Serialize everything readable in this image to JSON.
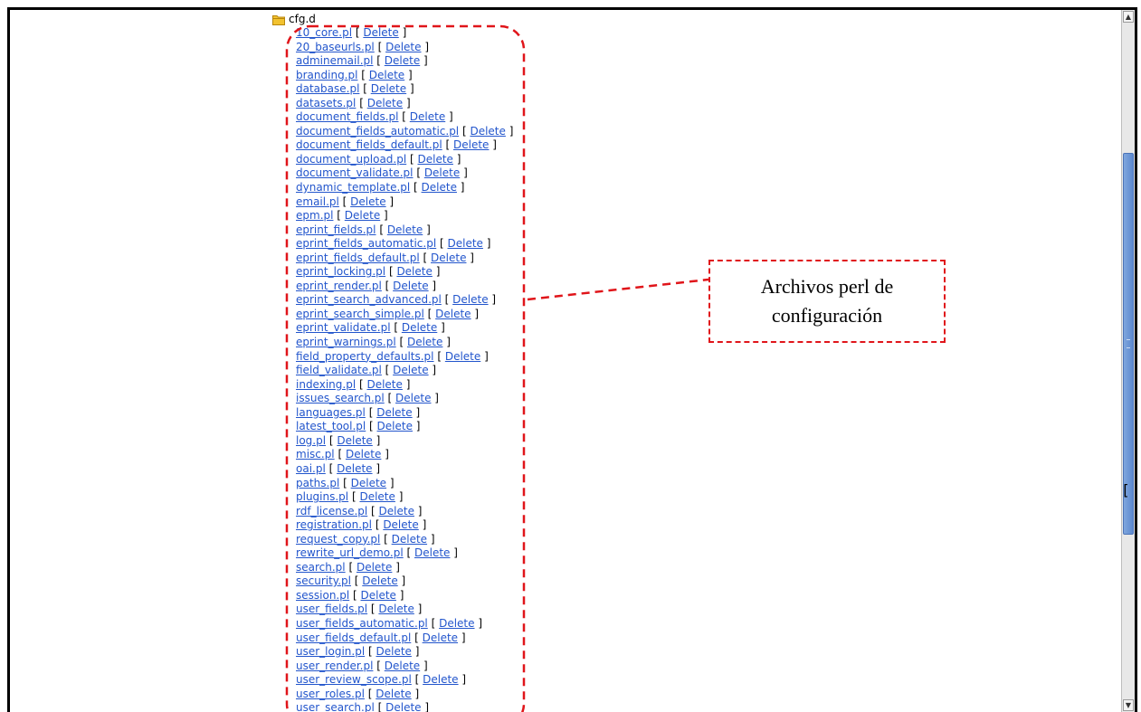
{
  "tree": {
    "folder_name": "cfg.d",
    "delete_label": "Delete",
    "files": [
      "10_core.pl",
      "20_baseurls.pl",
      "adminemail.pl",
      "branding.pl",
      "database.pl",
      "datasets.pl",
      "document_fields.pl",
      "document_fields_automatic.pl",
      "document_fields_default.pl",
      "document_upload.pl",
      "document_validate.pl",
      "dynamic_template.pl",
      "email.pl",
      "epm.pl",
      "eprint_fields.pl",
      "eprint_fields_automatic.pl",
      "eprint_fields_default.pl",
      "eprint_locking.pl",
      "eprint_render.pl",
      "eprint_search_advanced.pl",
      "eprint_search_simple.pl",
      "eprint_validate.pl",
      "eprint_warnings.pl",
      "field_property_defaults.pl",
      "field_validate.pl",
      "indexing.pl",
      "issues_search.pl",
      "languages.pl",
      "latest_tool.pl",
      "log.pl",
      "misc.pl",
      "oai.pl",
      "paths.pl",
      "plugins.pl",
      "rdf_license.pl",
      "registration.pl",
      "request_copy.pl",
      "rewrite_url_demo.pl",
      "search.pl",
      "security.pl",
      "session.pl",
      "user_fields.pl",
      "user_fields_automatic.pl",
      "user_fields_default.pl",
      "user_login.pl",
      "user_render.pl",
      "user_review_scope.pl",
      "user_roles.pl",
      "user_search.pl"
    ]
  },
  "annotation": {
    "line1": "Archivos perl de",
    "line2": "configuración",
    "color": "#e0151a"
  },
  "colors": {
    "link": "#2255cc",
    "folder": "#f2c230"
  },
  "icons": {
    "folder": "folder-icon",
    "scroll_up": "arrow-up-icon",
    "scroll_down": "arrow-down-icon"
  }
}
